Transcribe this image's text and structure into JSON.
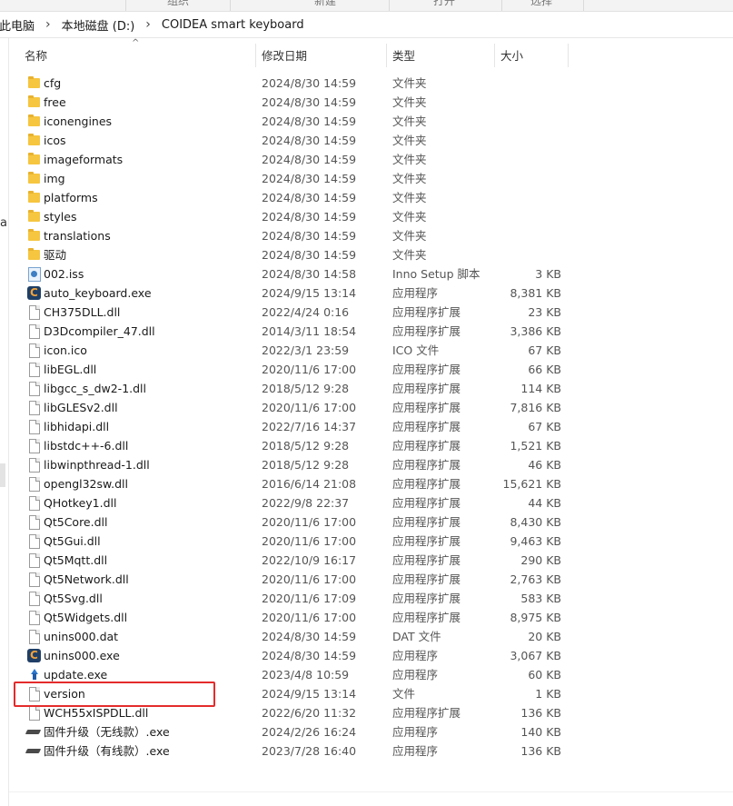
{
  "ribbon": {
    "labels": [
      "组织",
      "新建",
      "打开",
      "选择"
    ]
  },
  "address": {
    "crumbs": [
      "此电脑",
      "本地磁盘 (D:)",
      "COIDEA smart keyboard"
    ]
  },
  "leftnav": {
    "fragment": "a"
  },
  "columns": {
    "name": "名称",
    "date": "修改日期",
    "type": "类型",
    "size": "大小"
  },
  "files": [
    {
      "icon": "folder-icon",
      "name": "cfg",
      "date": "2024/8/30 14:59",
      "type": "文件夹",
      "size": ""
    },
    {
      "icon": "folder-icon",
      "name": "free",
      "date": "2024/8/30 14:59",
      "type": "文件夹",
      "size": ""
    },
    {
      "icon": "folder-icon",
      "name": "iconengines",
      "date": "2024/8/30 14:59",
      "type": "文件夹",
      "size": ""
    },
    {
      "icon": "folder-icon",
      "name": "icos",
      "date": "2024/8/30 14:59",
      "type": "文件夹",
      "size": ""
    },
    {
      "icon": "folder-icon",
      "name": "imageformats",
      "date": "2024/8/30 14:59",
      "type": "文件夹",
      "size": ""
    },
    {
      "icon": "folder-icon",
      "name": "img",
      "date": "2024/8/30 14:59",
      "type": "文件夹",
      "size": ""
    },
    {
      "icon": "folder-icon",
      "name": "platforms",
      "date": "2024/8/30 14:59",
      "type": "文件夹",
      "size": ""
    },
    {
      "icon": "folder-icon",
      "name": "styles",
      "date": "2024/8/30 14:59",
      "type": "文件夹",
      "size": ""
    },
    {
      "icon": "folder-icon",
      "name": "translations",
      "date": "2024/8/30 14:59",
      "type": "文件夹",
      "size": ""
    },
    {
      "icon": "folder-icon",
      "name": "驱动",
      "date": "2024/8/30 14:59",
      "type": "文件夹",
      "size": ""
    },
    {
      "icon": "inno-setup-icon",
      "name": "002.iss",
      "date": "2024/8/30 14:58",
      "type": "Inno Setup 脚本",
      "size": "3 KB"
    },
    {
      "icon": "coidea-app-icon",
      "name": "auto_keyboard.exe",
      "date": "2024/9/15 13:14",
      "type": "应用程序",
      "size": "8,381 KB"
    },
    {
      "icon": "file-icon",
      "name": "CH375DLL.dll",
      "date": "2022/4/24 0:16",
      "type": "应用程序扩展",
      "size": "23 KB"
    },
    {
      "icon": "file-icon",
      "name": "D3Dcompiler_47.dll",
      "date": "2014/3/11 18:54",
      "type": "应用程序扩展",
      "size": "3,386 KB"
    },
    {
      "icon": "file-icon",
      "name": "icon.ico",
      "date": "2022/3/1 23:59",
      "type": "ICO 文件",
      "size": "67 KB"
    },
    {
      "icon": "file-icon",
      "name": "libEGL.dll",
      "date": "2020/11/6 17:00",
      "type": "应用程序扩展",
      "size": "66 KB"
    },
    {
      "icon": "file-icon",
      "name": "libgcc_s_dw2-1.dll",
      "date": "2018/5/12 9:28",
      "type": "应用程序扩展",
      "size": "114 KB"
    },
    {
      "icon": "file-icon",
      "name": "libGLESv2.dll",
      "date": "2020/11/6 17:00",
      "type": "应用程序扩展",
      "size": "7,816 KB"
    },
    {
      "icon": "file-icon",
      "name": "libhidapi.dll",
      "date": "2022/7/16 14:37",
      "type": "应用程序扩展",
      "size": "67 KB"
    },
    {
      "icon": "file-icon",
      "name": "libstdc++-6.dll",
      "date": "2018/5/12 9:28",
      "type": "应用程序扩展",
      "size": "1,521 KB"
    },
    {
      "icon": "file-icon",
      "name": "libwinpthread-1.dll",
      "date": "2018/5/12 9:28",
      "type": "应用程序扩展",
      "size": "46 KB"
    },
    {
      "icon": "file-icon",
      "name": "opengl32sw.dll",
      "date": "2016/6/14 21:08",
      "type": "应用程序扩展",
      "size": "15,621 KB"
    },
    {
      "icon": "file-icon",
      "name": "QHotkey1.dll",
      "date": "2022/9/8 22:37",
      "type": "应用程序扩展",
      "size": "44 KB"
    },
    {
      "icon": "file-icon",
      "name": "Qt5Core.dll",
      "date": "2020/11/6 17:00",
      "type": "应用程序扩展",
      "size": "8,430 KB"
    },
    {
      "icon": "file-icon",
      "name": "Qt5Gui.dll",
      "date": "2020/11/6 17:00",
      "type": "应用程序扩展",
      "size": "9,463 KB"
    },
    {
      "icon": "file-icon",
      "name": "Qt5Mqtt.dll",
      "date": "2022/10/9 16:17",
      "type": "应用程序扩展",
      "size": "290 KB"
    },
    {
      "icon": "file-icon",
      "name": "Qt5Network.dll",
      "date": "2020/11/6 17:00",
      "type": "应用程序扩展",
      "size": "2,763 KB"
    },
    {
      "icon": "file-icon",
      "name": "Qt5Svg.dll",
      "date": "2020/11/6 17:09",
      "type": "应用程序扩展",
      "size": "583 KB"
    },
    {
      "icon": "file-icon",
      "name": "Qt5Widgets.dll",
      "date": "2020/11/6 17:00",
      "type": "应用程序扩展",
      "size": "8,975 KB"
    },
    {
      "icon": "file-icon",
      "name": "unins000.dat",
      "date": "2024/8/30 14:59",
      "type": "DAT 文件",
      "size": "20 KB"
    },
    {
      "icon": "coidea-app-icon",
      "name": "unins000.exe",
      "date": "2024/8/30 14:59",
      "type": "应用程序",
      "size": "3,067 KB"
    },
    {
      "icon": "update-icon",
      "name": "update.exe",
      "date": "2023/4/8 10:59",
      "type": "应用程序",
      "size": "60 KB"
    },
    {
      "icon": "file-icon",
      "name": "version",
      "date": "2024/9/15 13:14",
      "type": "文件",
      "size": "1 KB",
      "highlighted": true
    },
    {
      "icon": "file-icon",
      "name": "WCH55xISPDLL.dll",
      "date": "2022/6/20 11:32",
      "type": "应用程序扩展",
      "size": "136 KB"
    },
    {
      "icon": "flash-drive-icon",
      "name": "固件升级（无线款）.exe",
      "date": "2024/2/26 16:24",
      "type": "应用程序",
      "size": "140 KB"
    },
    {
      "icon": "flash-drive-icon",
      "name": "固件升级（有线款）.exe",
      "date": "2023/7/28 16:40",
      "type": "应用程序",
      "size": "136 KB"
    }
  ],
  "colors": {
    "highlight_border": "#e42b2b",
    "folder": "#f6c640",
    "app_icon": "#1f3f66"
  }
}
